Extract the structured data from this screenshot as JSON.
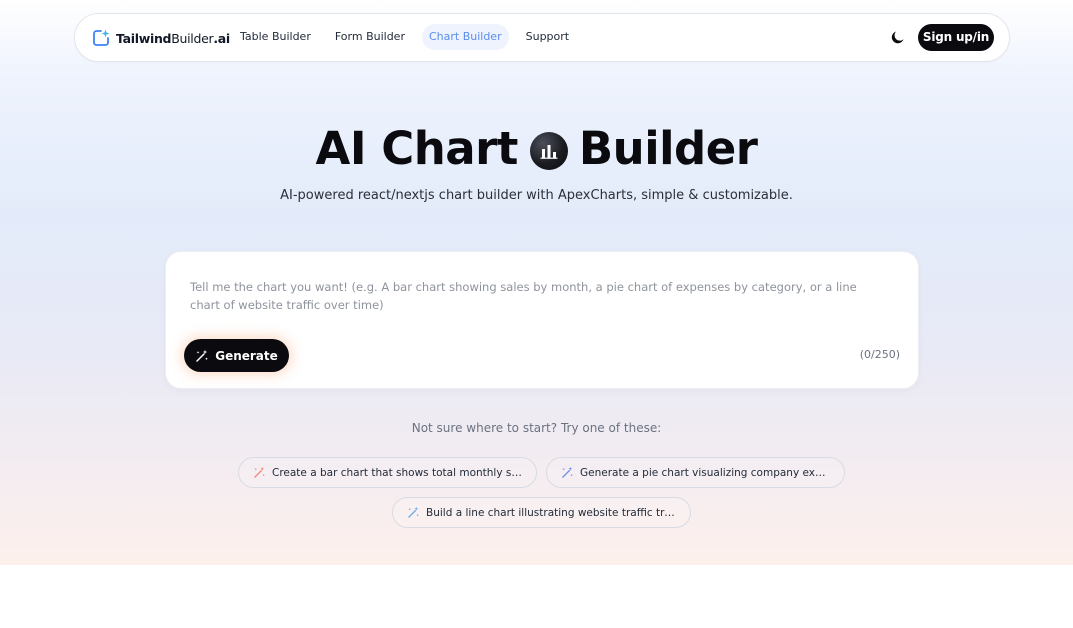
{
  "nav": {
    "logo": {
      "brand": "Tailwind",
      "brand_rest": "Builder",
      "suffix": ".ai",
      "icon": "logo-sparkle-icon"
    },
    "links": [
      {
        "label": "Table Builder",
        "active": false
      },
      {
        "label": "Form Builder",
        "active": false
      },
      {
        "label": "Chart Builder",
        "active": true
      },
      {
        "label": "Support",
        "active": false
      }
    ],
    "theme_toggle_icon": "moon-icon",
    "signup_label": "Sign up/in"
  },
  "hero": {
    "title_before": "AI Chart",
    "title_icon": "bar-chart-icon",
    "title_after": "Builder",
    "subtitle": "AI-powered react/nextjs chart builder with ApexCharts, simple & customizable."
  },
  "prompt": {
    "placeholder": "Tell me the chart you want! (e.g. A bar chart showing sales by month, a pie chart of expenses by category, or a line chart of website traffic over time)",
    "value": "",
    "generate_label": "Generate",
    "generate_icon": "magic-wand-icon",
    "counter": "(0/250)"
  },
  "suggestions": {
    "hint": "Not sure where to start? Try one of these:",
    "items": [
      {
        "label": "Create a bar chart that shows total monthly sales...",
        "icon_color": "#f08a7a"
      },
      {
        "label": "Generate a pie chart visualizing company expens...",
        "icon_color": "#6f8fe8"
      },
      {
        "label": "Build a line chart illustrating website traffic trend...",
        "icon_color": "#6fa8e8"
      }
    ]
  },
  "colors": {
    "accent": "#5b8def",
    "dark": "#0b0b0f"
  }
}
